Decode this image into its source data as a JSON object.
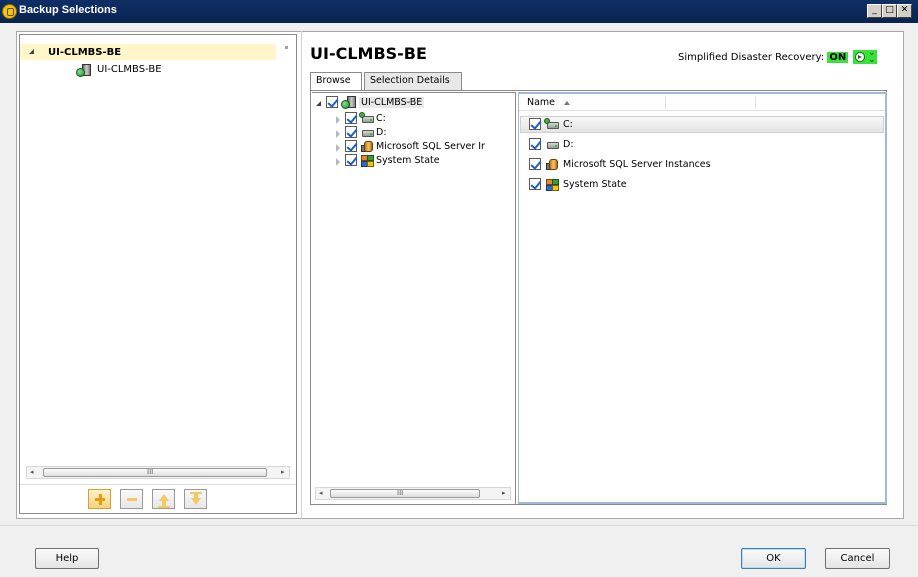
{
  "window": {
    "title": "Backup Selections",
    "controls": [
      "_",
      "□",
      "✕"
    ]
  },
  "left_panel": {
    "root_item": "UI-CLMBS-BE",
    "child_item": "UI-CLMBS-BE",
    "scroll_grip": "III",
    "toolbar": [
      "add",
      "remove",
      "move-up",
      "move-down"
    ]
  },
  "main": {
    "server_name": "UI-CLMBS-BE",
    "sdr_label": "Simplified Disaster Recovery:",
    "sdr_status": "ON",
    "tabs": [
      {
        "label": "Browse",
        "active": true
      },
      {
        "label": "Selection Details",
        "active": false
      }
    ],
    "tree": {
      "root": "UI-CLMBS-BE",
      "children": [
        "C:",
        "D:",
        "Microsoft SQL Server Ir",
        "System State"
      ],
      "scroll_grip": "III"
    },
    "list": {
      "column": "Name",
      "rows": [
        "C:",
        "D:",
        "Microsoft SQL Server Instances",
        "System State"
      ]
    }
  },
  "buttons": {
    "help": "Help",
    "ok": "OK",
    "cancel": "Cancel"
  }
}
